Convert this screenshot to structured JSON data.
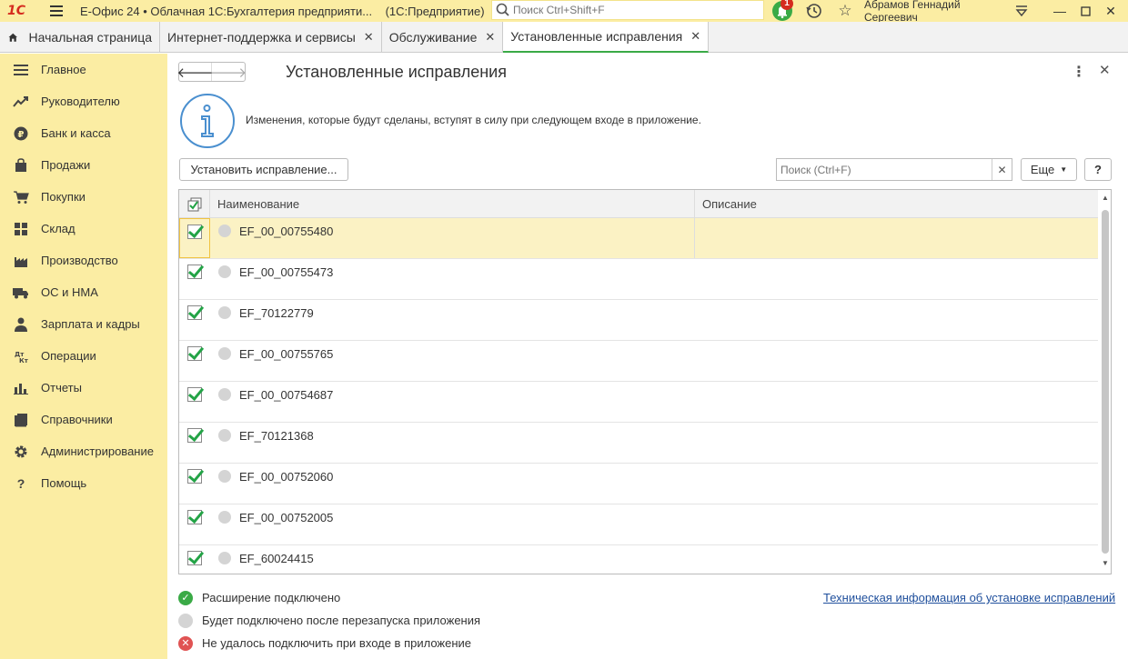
{
  "titlebar": {
    "logo": "1С",
    "title": "Е-Офис 24 • Облачная 1С:Бухгалтерия предприяти...",
    "platform": "(1С:Предприятие)",
    "search_placeholder": "Поиск Ctrl+Shift+F",
    "notification_count": "1",
    "user_name": "Абрамов Геннадий Сергеевич"
  },
  "tabs": [
    {
      "label": "Начальная страница"
    },
    {
      "label": "Интернет-поддержка и сервисы"
    },
    {
      "label": "Обслуживание"
    },
    {
      "label": "Установленные исправления"
    }
  ],
  "sidebar": {
    "items": [
      {
        "label": "Главное",
        "icon": "menu-lines-icon"
      },
      {
        "label": "Руководителю",
        "icon": "trend-icon"
      },
      {
        "label": "Банк и касса",
        "icon": "ruble-icon"
      },
      {
        "label": "Продажи",
        "icon": "bag-icon"
      },
      {
        "label": "Покупки",
        "icon": "cart-icon"
      },
      {
        "label": "Склад",
        "icon": "warehouse-icon"
      },
      {
        "label": "Производство",
        "icon": "factory-icon"
      },
      {
        "label": "ОС и НМА",
        "icon": "truck-icon"
      },
      {
        "label": "Зарплата и кадры",
        "icon": "person-icon"
      },
      {
        "label": "Операции",
        "icon": "dt-kt-icon"
      },
      {
        "label": "Отчеты",
        "icon": "bar-chart-icon"
      },
      {
        "label": "Справочники",
        "icon": "book-icon"
      },
      {
        "label": "Администрирование",
        "icon": "gear-icon"
      },
      {
        "label": "Помощь",
        "icon": "question-icon"
      }
    ]
  },
  "page": {
    "title": "Установленные исправления",
    "info_text": "Изменения, которые будут сделаны, вступят в силу при следующем входе в приложение.",
    "install_button": "Установить исправление...",
    "search_placeholder": "Поиск (Ctrl+F)",
    "more_button": "Еще",
    "help_button": "?"
  },
  "table": {
    "columns": [
      "Наименование",
      "Описание"
    ],
    "rows": [
      {
        "name": "EF_00_00755480",
        "description": ""
      },
      {
        "name": "EF_00_00755473",
        "description": ""
      },
      {
        "name": "EF_70122779",
        "description": ""
      },
      {
        "name": "EF_00_00755765",
        "description": ""
      },
      {
        "name": "EF_00_00754687",
        "description": ""
      },
      {
        "name": "EF_70121368",
        "description": ""
      },
      {
        "name": "EF_00_00752060",
        "description": ""
      },
      {
        "name": "EF_00_00752005",
        "description": ""
      },
      {
        "name": "EF_60024415",
        "description": ""
      }
    ]
  },
  "legend": {
    "connected": "Расширение подключено",
    "after_restart": "Будет подключено после перезапуска приложения",
    "failed": "Не удалось подключить при входе в приложение",
    "tech_link": "Техническая информация об установке исправлений"
  },
  "colors": {
    "accent_yellow": "#fbeda3",
    "green": "#3aaa46",
    "red": "#d52b1e",
    "link": "#1f4f9c"
  }
}
